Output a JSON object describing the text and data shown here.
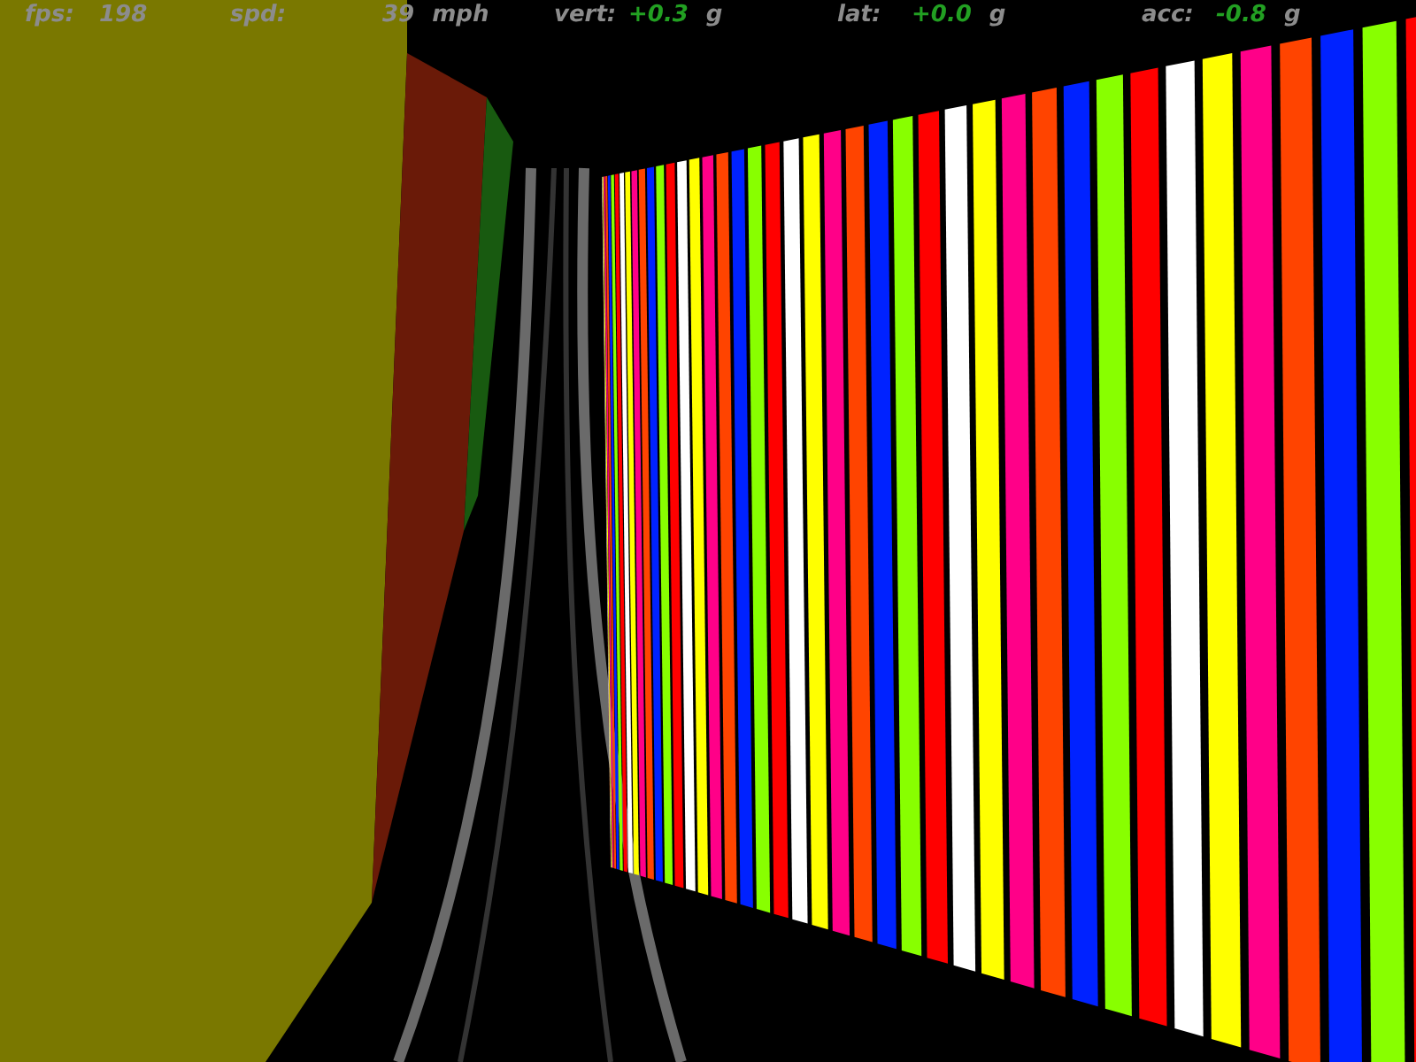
{
  "hud": [
    {
      "label": "fps:",
      "value": "198",
      "color": "#8c8c8c"
    },
    {
      "label": "spd:",
      "value": "39",
      "unit": "mph",
      "color": "#8c8c8c"
    },
    {
      "label": "vert:",
      "value": "+0.3",
      "unit": "g",
      "color": "#22a022"
    },
    {
      "label": "lat:",
      "value": "+0.0",
      "unit": "g",
      "color": "#22a022"
    },
    {
      "label": "acc:",
      "value": "-0.8",
      "unit": "g",
      "color": "#22a022"
    }
  ]
}
